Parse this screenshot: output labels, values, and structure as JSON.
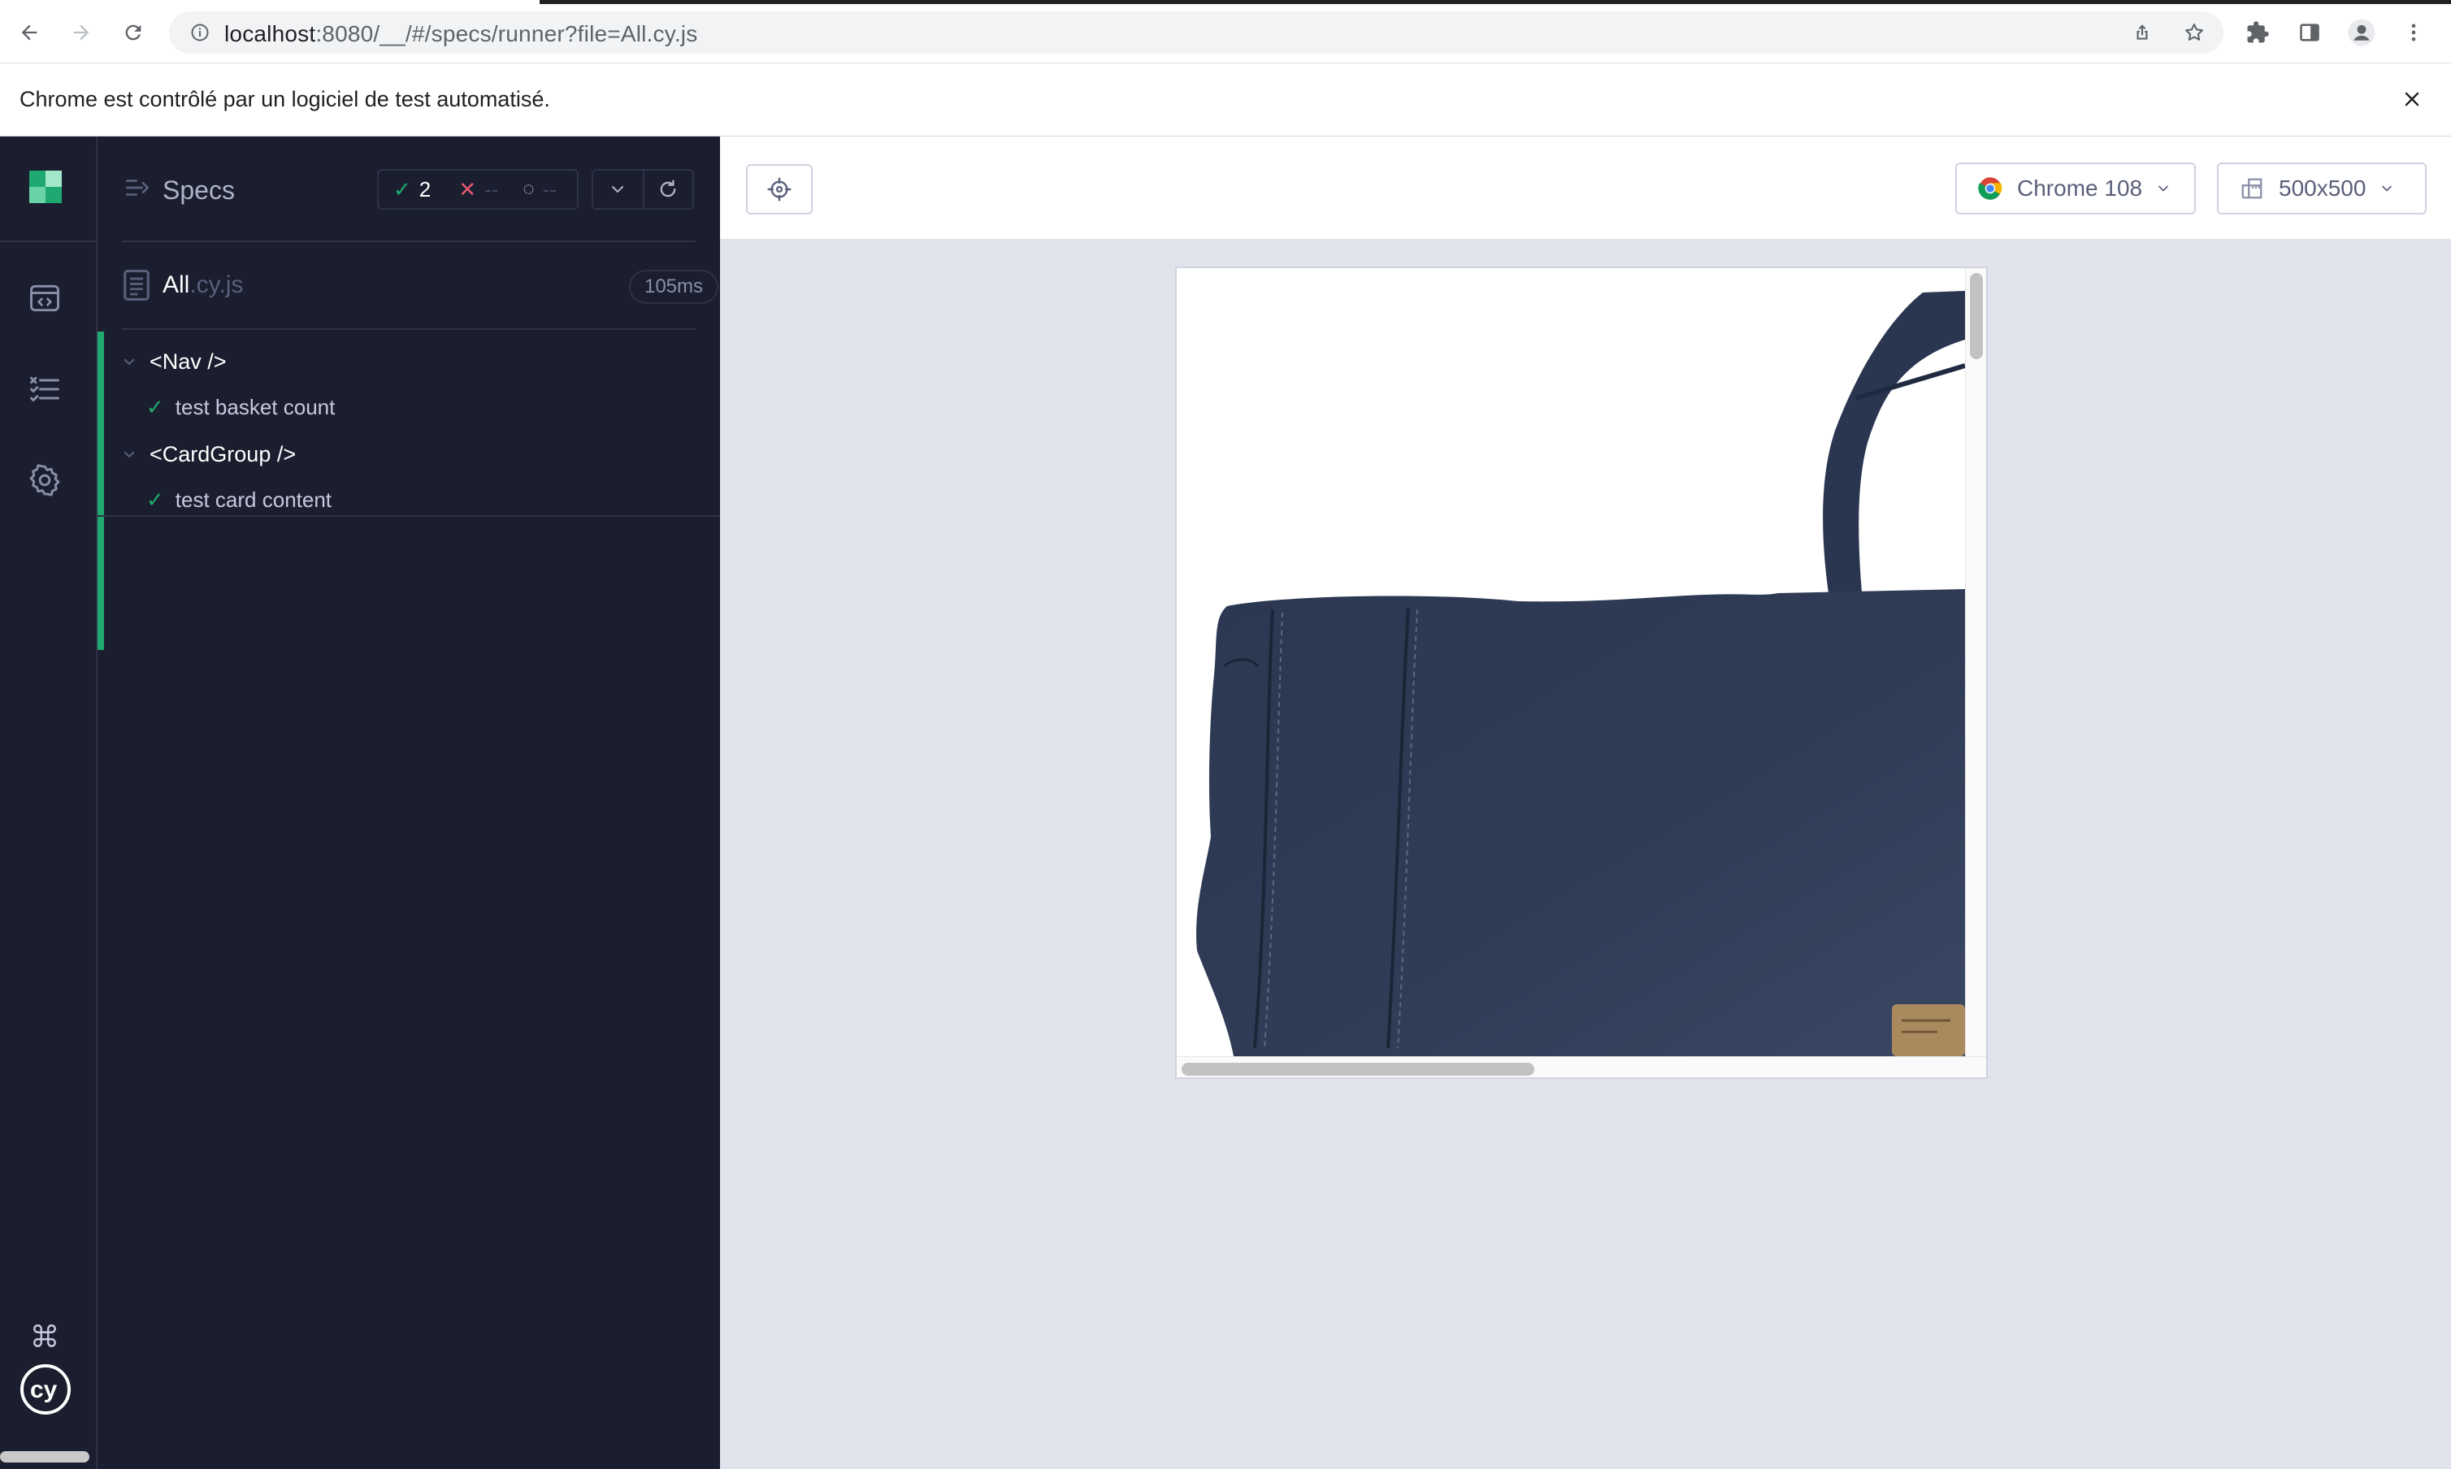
{
  "browser": {
    "url_host": "localhost",
    "url_rest": ":8080/__/#/specs/runner?file=All.cy.js",
    "infobar_message": "Chrome est contrôlé par un logiciel de test automatisé."
  },
  "leftnav": {
    "items": [
      "runs",
      "specs",
      "settings"
    ],
    "bottom": [
      "keyboard-shortcuts",
      "cypress-logo"
    ]
  },
  "reporter": {
    "title": "Specs",
    "stats": {
      "passed": "2",
      "failed": "--",
      "pending": "--"
    },
    "spec": {
      "name": "All",
      "ext": ".cy.js",
      "duration": "105ms"
    },
    "suites": [
      {
        "title": "<Nav />",
        "tests": [
          "test basket count"
        ]
      },
      {
        "title": "<CardGroup />",
        "tests": [
          "test card content"
        ]
      }
    ]
  },
  "aut": {
    "browser_label": "Chrome 108",
    "viewport_label": "500x500"
  },
  "colors": {
    "pass": "#1fa971",
    "fail": "#e45770",
    "sidebar_bg": "#1b1e2e",
    "aut_bg": "#e1e3ed"
  }
}
